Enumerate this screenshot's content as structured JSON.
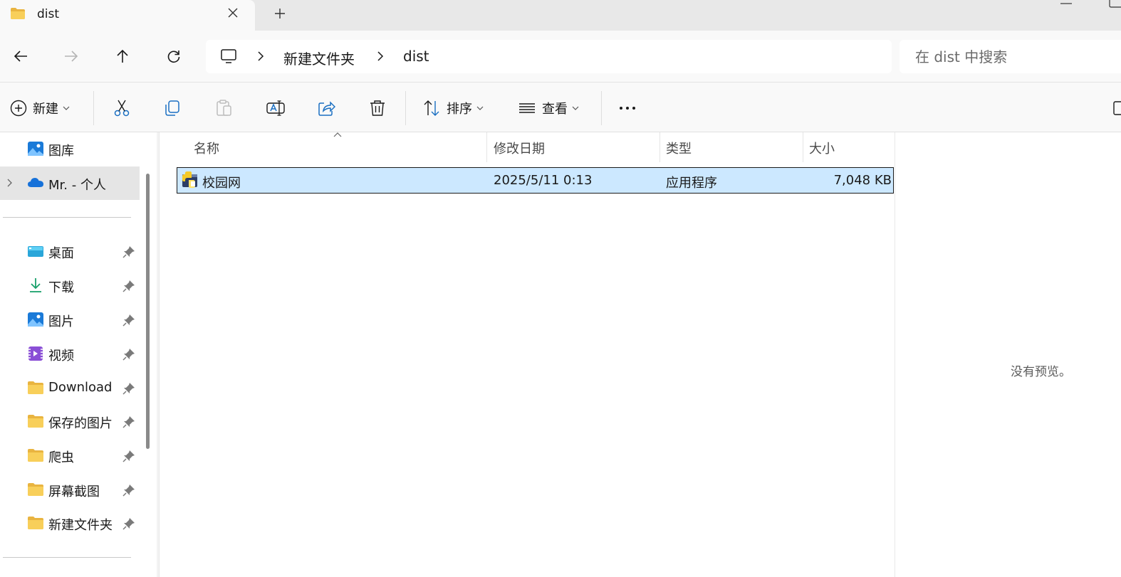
{
  "tab": {
    "title": "dist",
    "new_tab_symbol": "+"
  },
  "icons": {
    "tab": "folder-icon",
    "close": "close-icon",
    "back": "arrow-left-icon",
    "forward": "arrow-right-icon",
    "up": "arrow-up-icon",
    "refresh": "refresh-icon",
    "computer": "monitor-icon",
    "pin": "pin-icon"
  },
  "address": {
    "crumbs": [
      "新建文件夹",
      "dist"
    ],
    "search_placeholder": "在 dist 中搜索"
  },
  "toolbar": {
    "new_label": "新建",
    "sort_label": "排序",
    "view_label": "查看"
  },
  "sidebar": {
    "gallery": "图库",
    "onedrive": "Mr. - 个人",
    "items": [
      {
        "label": "桌面",
        "icon": "desktop-icon"
      },
      {
        "label": "下载",
        "icon": "download-icon"
      },
      {
        "label": "图片",
        "icon": "pictures-icon"
      },
      {
        "label": "视频",
        "icon": "videos-icon"
      },
      {
        "label": "Download",
        "icon": "folder-icon"
      },
      {
        "label": "保存的图片",
        "icon": "folder-icon"
      },
      {
        "label": "爬虫",
        "icon": "folder-icon"
      },
      {
        "label": "屏幕截图",
        "icon": "folder-icon"
      },
      {
        "label": "新建文件夹",
        "icon": "folder-icon"
      }
    ]
  },
  "columns": {
    "name": "名称",
    "date": "修改日期",
    "type": "类型",
    "size": "大小"
  },
  "files": [
    {
      "name": "校园网",
      "date": "2025/5/11 0:13",
      "type": "应用程序",
      "size": "7,048 KB",
      "icon": "python-exe-icon"
    }
  ],
  "preview": {
    "text": "没有预览。"
  },
  "colors": {
    "selection": "#cce8ff",
    "accent": "#0067c0",
    "folder": "#f4c542"
  }
}
